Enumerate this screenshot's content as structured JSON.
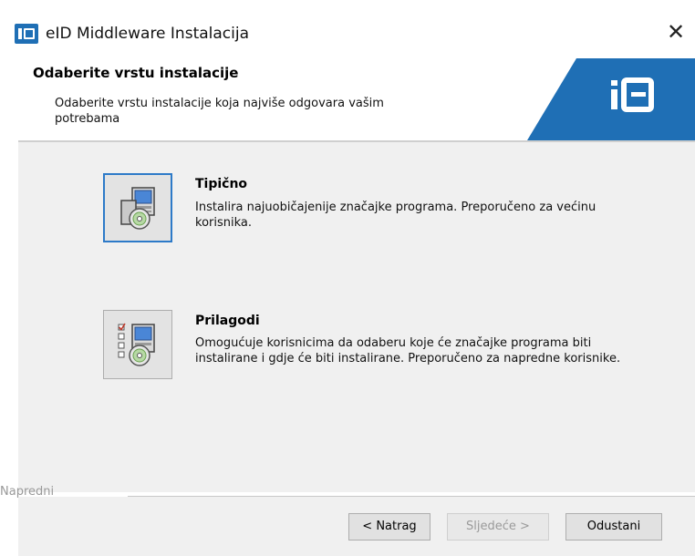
{
  "window": {
    "title": "eID Middleware Instalacija",
    "close_glyph": "✕"
  },
  "banner": {
    "title": "Odaberite vrstu instalacije",
    "description": "Odaberite vrstu instalacije koja najviše odgovara vašim potrebama",
    "brand_color": "#1f6fb5"
  },
  "options": [
    {
      "title": "Tipično",
      "description": "Instalira najuobičajenije značajke programa. Preporučeno za većinu korisnika.",
      "icon": "typical-install-icon"
    },
    {
      "title": "Prilagodi",
      "description": "Omogućuje korisnicima da odaberu koje će značajke programa biti instalirane i gdje će biti instalirane. Preporučeno za napredne korisnike.",
      "icon": "custom-install-icon"
    }
  ],
  "advanced": {
    "label": "Napredni"
  },
  "buttons": {
    "back": "< Natrag",
    "next": "Sljedeće >",
    "cancel": "Odustani"
  },
  "colors": {
    "focus": "#2d7ac8",
    "content_bg": "#f0f0f0"
  }
}
